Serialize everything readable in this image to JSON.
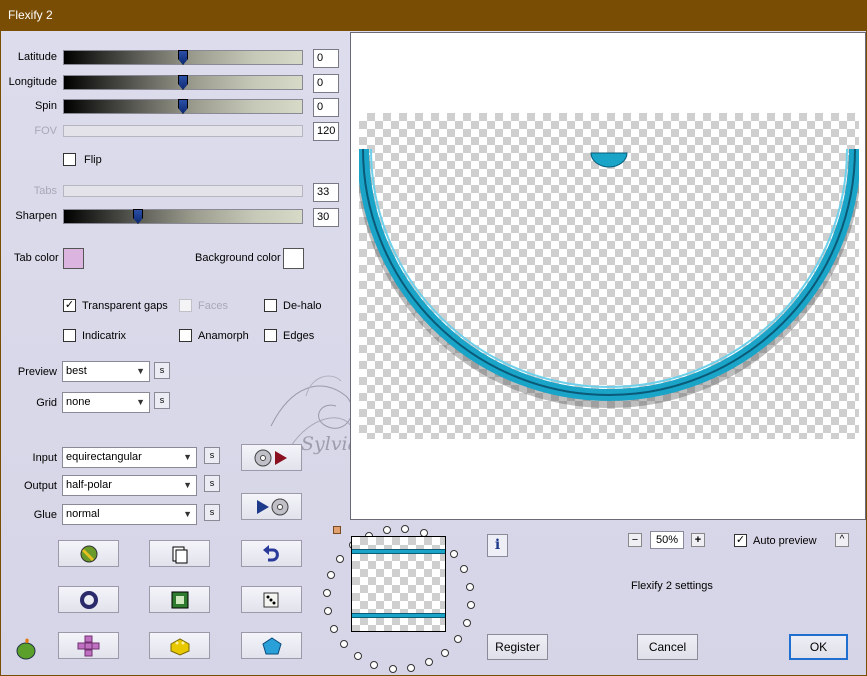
{
  "window": {
    "title": "Flexify 2"
  },
  "sliders": {
    "latitude": {
      "label": "Latitude",
      "value": "0",
      "level": 0.5
    },
    "longitude": {
      "label": "Longitude",
      "value": "0",
      "level": 0.5
    },
    "spin": {
      "label": "Spin",
      "value": "0",
      "level": 0.5
    },
    "fov": {
      "label": "FOV",
      "value": "120",
      "level": 0.0
    },
    "tabs": {
      "label": "Tabs",
      "value": "33",
      "level": 0.0
    },
    "sharpen": {
      "label": "Sharpen",
      "value": "30",
      "level": 0.3
    }
  },
  "flip": {
    "label": "Flip",
    "checked": false
  },
  "colors": {
    "tab_color_label": "Tab color",
    "tab_color": "#dcb4e0",
    "background_color_label": "Background color",
    "background_color": "#ffffff"
  },
  "options": {
    "transparent_gaps": {
      "label": "Transparent gaps",
      "checked": true
    },
    "faces": {
      "label": "Faces",
      "checked": false
    },
    "de_halo": {
      "label": "De-halo",
      "checked": false
    },
    "indicatrix": {
      "label": "Indicatrix",
      "checked": false
    },
    "anamorph": {
      "label": "Anamorph",
      "checked": false
    },
    "edges": {
      "label": "Edges",
      "checked": false
    }
  },
  "combos": {
    "preview": {
      "label": "Preview",
      "value": "best"
    },
    "grid": {
      "label": "Grid",
      "value": "none"
    },
    "input": {
      "label": "Input",
      "value": "equirectangular"
    },
    "output": {
      "label": "Output",
      "value": "half-polar"
    },
    "glue": {
      "label": "Glue",
      "value": "normal"
    }
  },
  "small_button_label": "s",
  "watermark": "Sylviane",
  "zoom": {
    "minus": "−",
    "value": "50%",
    "plus": "+"
  },
  "auto_preview": {
    "label": "Auto preview",
    "checked": true
  },
  "collapse_glyph": "^",
  "settings_title": "Flexify 2 settings",
  "info_glyph": "i",
  "buttons": {
    "register": "Register",
    "cancel": "Cancel",
    "ok": "OK"
  },
  "accent": "#1fa3c4"
}
